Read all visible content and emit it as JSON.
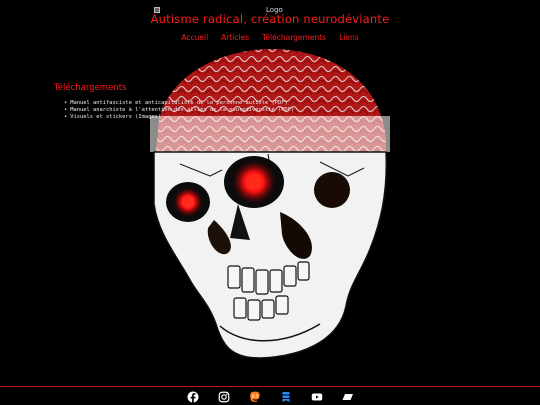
{
  "header": {
    "logo_alt": "Logo",
    "site_title": "Autisme radical, création neurodéviante"
  },
  "nav": [
    {
      "label": "Accueil"
    },
    {
      "label": "Articles"
    },
    {
      "label": "Téléchargements"
    },
    {
      "label": "Liens"
    }
  ],
  "main": {
    "section_title": "Téléchargements",
    "downloads": [
      {
        "label": "Manuel antifasciste et anticapitaliste de la personne autiste (PDF)"
      },
      {
        "label": "Manuel anarchiste à l'attention des alliés de la neurodiversité (PDF)"
      },
      {
        "label": "Visuels et stickers (Images)"
      }
    ]
  },
  "footer": {
    "social": [
      {
        "icon": "facebook-icon"
      },
      {
        "icon": "instagram-icon"
      },
      {
        "icon": "mastodon-icon"
      },
      {
        "icon": "bluesky-icon"
      },
      {
        "icon": "youtube-icon"
      },
      {
        "icon": "ko-fi-icon"
      }
    ]
  },
  "colors": {
    "background": "#000000",
    "accent": "#ff1a1a",
    "text": "#eeeeee",
    "footer_border": "#c01010"
  }
}
